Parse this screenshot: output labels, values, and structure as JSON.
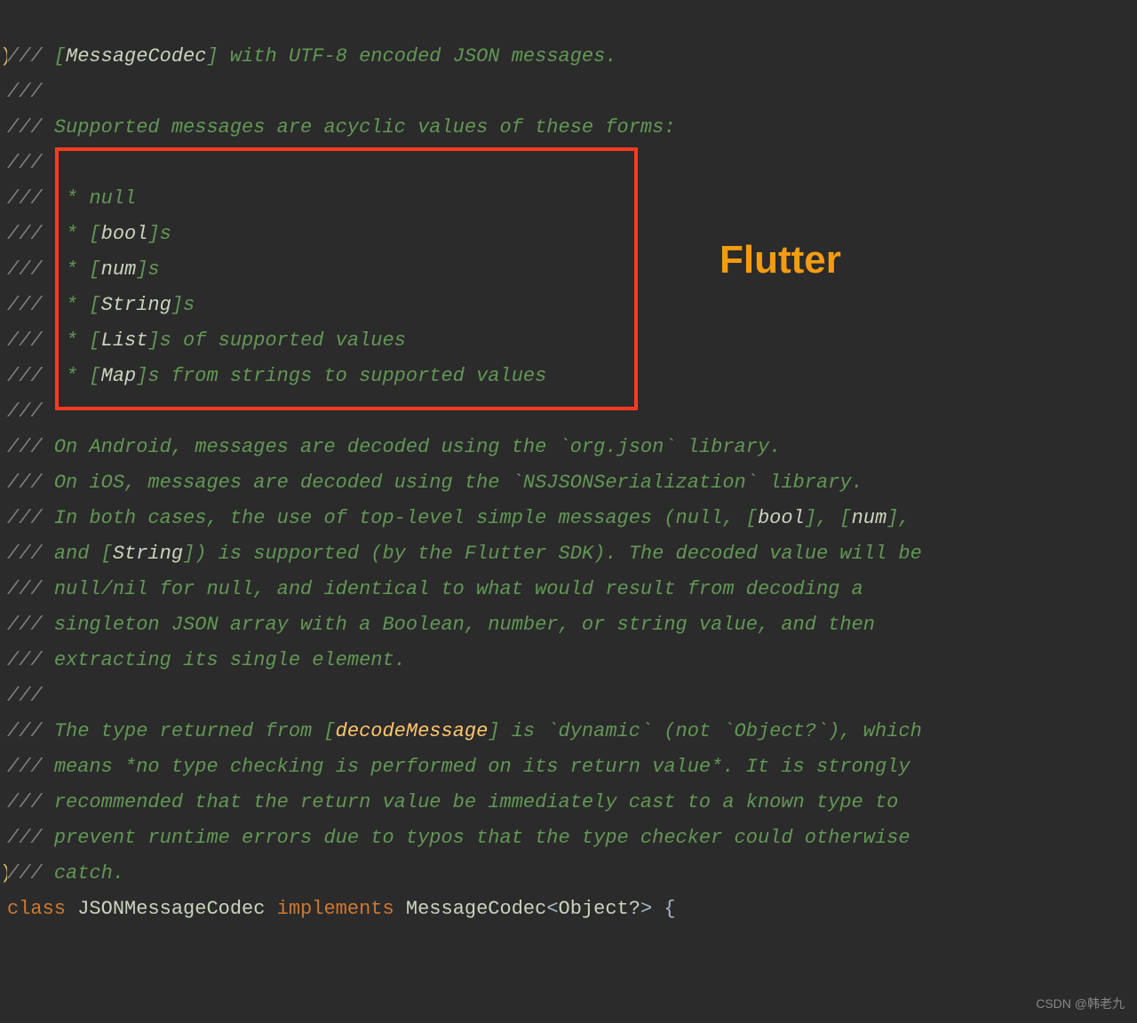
{
  "annotation": {
    "label": "Flutter",
    "watermark": "CSDN @韩老九"
  },
  "lines": [
    {
      "gutter": ")",
      "segs": [
        {
          "t": "/// ",
          "c": "slashes"
        },
        {
          "t": "[",
          "c": "comment"
        },
        {
          "t": "MessageCodec",
          "c": "ref"
        },
        {
          "t": "] with UTF-8 encoded JSON messages.",
          "c": "comment"
        }
      ]
    },
    {
      "gutter": "",
      "segs": [
        {
          "t": "///",
          "c": "slashes"
        }
      ]
    },
    {
      "gutter": "",
      "segs": [
        {
          "t": "/// ",
          "c": "slashes"
        },
        {
          "t": "Supported messages are acyclic values of these forms:",
          "c": "comment"
        }
      ]
    },
    {
      "gutter": "",
      "segs": [
        {
          "t": "///",
          "c": "slashes"
        }
      ]
    },
    {
      "gutter": "",
      "segs": [
        {
          "t": "///  ",
          "c": "slashes"
        },
        {
          "t": "* null",
          "c": "comment"
        }
      ]
    },
    {
      "gutter": "",
      "segs": [
        {
          "t": "///  ",
          "c": "slashes"
        },
        {
          "t": "* [",
          "c": "comment"
        },
        {
          "t": "bool",
          "c": "ref"
        },
        {
          "t": "]s",
          "c": "comment"
        }
      ]
    },
    {
      "gutter": "",
      "segs": [
        {
          "t": "///  ",
          "c": "slashes"
        },
        {
          "t": "* [",
          "c": "comment"
        },
        {
          "t": "num",
          "c": "ref"
        },
        {
          "t": "]s",
          "c": "comment"
        }
      ]
    },
    {
      "gutter": "",
      "segs": [
        {
          "t": "///  ",
          "c": "slashes"
        },
        {
          "t": "* [",
          "c": "comment"
        },
        {
          "t": "String",
          "c": "ref"
        },
        {
          "t": "]s",
          "c": "comment"
        }
      ]
    },
    {
      "gutter": "",
      "segs": [
        {
          "t": "///  ",
          "c": "slashes"
        },
        {
          "t": "* [",
          "c": "comment"
        },
        {
          "t": "List",
          "c": "ref"
        },
        {
          "t": "]s of supported values",
          "c": "comment"
        }
      ]
    },
    {
      "gutter": "",
      "segs": [
        {
          "t": "///  ",
          "c": "slashes"
        },
        {
          "t": "* [",
          "c": "comment"
        },
        {
          "t": "Map",
          "c": "ref"
        },
        {
          "t": "]s from strings to supported values",
          "c": "comment"
        }
      ]
    },
    {
      "gutter": "",
      "segs": [
        {
          "t": "///",
          "c": "slashes"
        }
      ]
    },
    {
      "gutter": "",
      "segs": [
        {
          "t": "/// ",
          "c": "slashes"
        },
        {
          "t": "On Android, messages are decoded using the `org.json` library.",
          "c": "comment"
        }
      ]
    },
    {
      "gutter": "",
      "segs": [
        {
          "t": "/// ",
          "c": "slashes"
        },
        {
          "t": "On iOS, messages are decoded using the `NSJSONSerialization` library.",
          "c": "comment"
        }
      ]
    },
    {
      "gutter": "",
      "segs": [
        {
          "t": "/// ",
          "c": "slashes"
        },
        {
          "t": "In both cases, the use of top-level simple messages (null, [",
          "c": "comment"
        },
        {
          "t": "bool",
          "c": "ref"
        },
        {
          "t": "], [",
          "c": "comment"
        },
        {
          "t": "num",
          "c": "ref"
        },
        {
          "t": "],",
          "c": "comment"
        }
      ]
    },
    {
      "gutter": "",
      "segs": [
        {
          "t": "/// ",
          "c": "slashes"
        },
        {
          "t": "and [",
          "c": "comment"
        },
        {
          "t": "String",
          "c": "ref"
        },
        {
          "t": "]) is supported (by the Flutter SDK). The decoded value will be",
          "c": "comment"
        }
      ]
    },
    {
      "gutter": "",
      "segs": [
        {
          "t": "/// ",
          "c": "slashes"
        },
        {
          "t": "null/nil for null, and identical to what would result from decoding a",
          "c": "comment"
        }
      ]
    },
    {
      "gutter": "",
      "segs": [
        {
          "t": "/// ",
          "c": "slashes"
        },
        {
          "t": "singleton JSON array with a Boolean, number, or string value, and then",
          "c": "comment"
        }
      ]
    },
    {
      "gutter": "",
      "segs": [
        {
          "t": "/// ",
          "c": "slashes"
        },
        {
          "t": "extracting its single element.",
          "c": "comment"
        }
      ]
    },
    {
      "gutter": "",
      "segs": [
        {
          "t": "///",
          "c": "slashes"
        }
      ]
    },
    {
      "gutter": "",
      "segs": [
        {
          "t": "/// ",
          "c": "slashes"
        },
        {
          "t": "The type returned from [",
          "c": "comment"
        },
        {
          "t": "decodeMessage",
          "c": "ref-strong"
        },
        {
          "t": "] is `dynamic` (not `Object?`), which",
          "c": "comment"
        }
      ]
    },
    {
      "gutter": "",
      "segs": [
        {
          "t": "/// ",
          "c": "slashes"
        },
        {
          "t": "means *no type checking is performed on its return value*. It is strongly",
          "c": "comment"
        }
      ]
    },
    {
      "gutter": "",
      "segs": [
        {
          "t": "/// ",
          "c": "slashes"
        },
        {
          "t": "recommended that the return value be immediately cast to a known type to",
          "c": "comment"
        }
      ]
    },
    {
      "gutter": "",
      "segs": [
        {
          "t": "/// ",
          "c": "slashes"
        },
        {
          "t": "prevent runtime errors due to typos that the type checker could otherwise",
          "c": "comment"
        }
      ]
    },
    {
      "gutter": ")",
      "segs": [
        {
          "t": "/// ",
          "c": "slashes"
        },
        {
          "t": "catch.",
          "c": "comment"
        }
      ]
    },
    {
      "gutter": "",
      "noItalic": true,
      "segs": [
        {
          "t": "class ",
          "c": "kw"
        },
        {
          "t": "JSONMessageCodec ",
          "c": "cls"
        },
        {
          "t": "implements ",
          "c": "kw"
        },
        {
          "t": "MessageCodec",
          "c": "type"
        },
        {
          "t": "<",
          "c": "punct"
        },
        {
          "t": "Object?",
          "c": "type"
        },
        {
          "t": "> {",
          "c": "punct"
        }
      ]
    }
  ]
}
